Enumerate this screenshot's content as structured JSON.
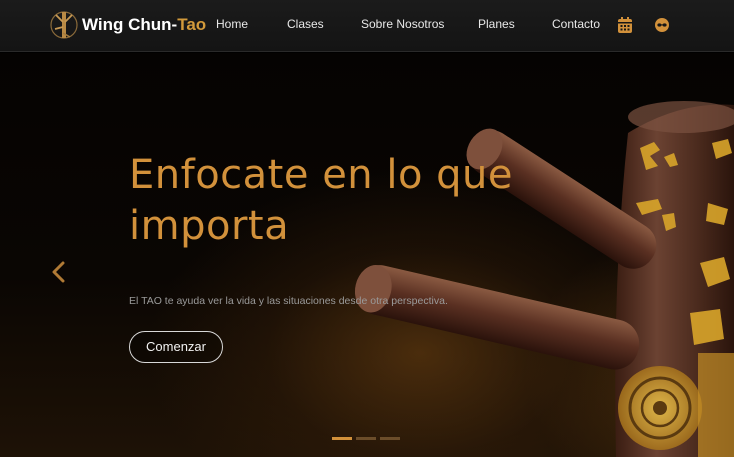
{
  "brand": {
    "name_main": "Wing Chun-",
    "name_accent": "Tao",
    "logo_icon": "wooden-dummy-logo-icon"
  },
  "nav": {
    "items": [
      {
        "label": "Home"
      },
      {
        "label": "Clases"
      },
      {
        "label": "Sobre Nosotros"
      },
      {
        "label": "Planes"
      },
      {
        "label": "Contacto"
      }
    ],
    "icons": [
      "calendar-icon",
      "user-mask-icon"
    ]
  },
  "hero": {
    "title": "Enfocate en lo que importa",
    "subtitle": "El TAO te ayuda ver la vida y las situaciones desde otra perspectiva.",
    "cta_label": "Comenzar",
    "slides_total": 3,
    "active_slide": 1
  },
  "colors": {
    "accent": "#d2913b",
    "navbar": "#161616",
    "background": "#050302"
  }
}
